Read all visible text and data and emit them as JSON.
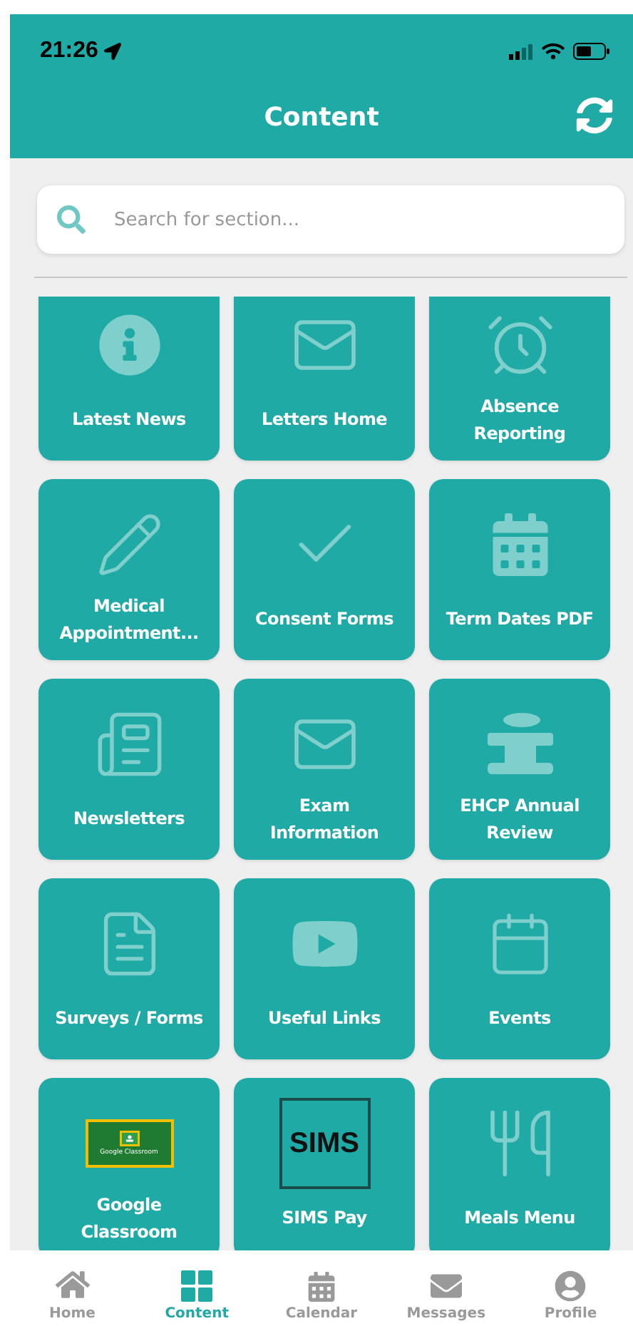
{
  "status_bar": {
    "time": "21:26"
  },
  "header": {
    "title": "Content"
  },
  "search": {
    "placeholder": "Search for section..."
  },
  "tiles": [
    {
      "kind": "icon",
      "label": "Latest News"
    },
    {
      "kind": "icon",
      "label": "Letters Home"
    },
    {
      "kind": "icon",
      "label": "Absence Reporting"
    },
    {
      "kind": "icon",
      "label": "Medical Appointment..."
    },
    {
      "kind": "icon",
      "label": "Consent Forms"
    },
    {
      "kind": "icon",
      "label": "Term Dates PDF"
    },
    {
      "kind": "icon",
      "label": "Newsletters"
    },
    {
      "kind": "icon",
      "label": "Exam Information"
    },
    {
      "kind": "icon",
      "label": "EHCP Annual Review"
    },
    {
      "kind": "icon",
      "label": "Surveys / Forms"
    },
    {
      "kind": "icon",
      "label": "Useful Links"
    },
    {
      "kind": "icon",
      "label": "Events"
    },
    {
      "kind": "badge_logo",
      "label": "Google Classroom",
      "logo_text": "Google Classroom"
    },
    {
      "kind": "box_logo",
      "label": "SIMS Pay",
      "logo_text": "SIMS"
    },
    {
      "kind": "icon",
      "label": "Meals Menu"
    }
  ],
  "tab_bar": [
    {
      "label": "Home",
      "selected": false
    },
    {
      "label": "Content",
      "selected": true
    },
    {
      "label": "Calendar",
      "selected": false
    },
    {
      "label": "Messages",
      "selected": false
    },
    {
      "label": "Profile",
      "selected": false
    }
  ]
}
